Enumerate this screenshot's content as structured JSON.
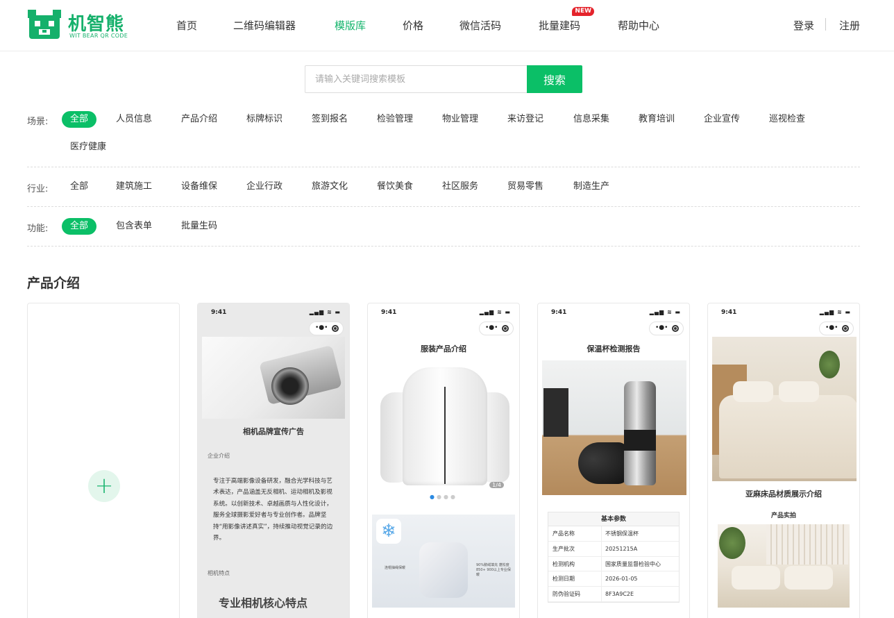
{
  "brand": {
    "name": "机智熊",
    "subtitle": "WIT BEAR QR CODE",
    "color": "#15b06b"
  },
  "nav": {
    "items": [
      {
        "label": "首页",
        "active": false
      },
      {
        "label": "二维码编辑器",
        "active": false
      },
      {
        "label": "模版库",
        "active": true
      },
      {
        "label": "价格",
        "active": false
      },
      {
        "label": "微信活码",
        "active": false
      },
      {
        "label": "批量建码",
        "active": false,
        "badge": "NEW"
      },
      {
        "label": "帮助中心",
        "active": false
      }
    ],
    "login": "登录",
    "register": "注册"
  },
  "search": {
    "placeholder": "请输入关键词搜索模板",
    "value": "",
    "button": "搜索"
  },
  "filters": {
    "scene": {
      "label": "场景:",
      "options": [
        "全部",
        "人员信息",
        "产品介绍",
        "标牌标识",
        "签到报名",
        "检验管理",
        "物业管理",
        "来访登记",
        "信息采集",
        "教育培训",
        "企业宣传",
        "巡视检查",
        "医疗健康"
      ],
      "selected": "全部"
    },
    "industry": {
      "label": "行业:",
      "options": [
        "全部",
        "建筑施工",
        "设备维保",
        "企业行政",
        "旅游文化",
        "餐饮美食",
        "社区服务",
        "贸易零售",
        "制造生产"
      ],
      "selected": ""
    },
    "feature": {
      "label": "功能:",
      "options": [
        "全部",
        "包含表单",
        "批量生码"
      ],
      "selected": "全部"
    }
  },
  "section": {
    "title": "产品介绍"
  },
  "phone": {
    "time": "9:41",
    "status_icons": "▂▄▆ ≋ ▬",
    "capsule_dots": "•●•"
  },
  "templates": {
    "add_icon": "plus-icon",
    "camera": {
      "title": "相机品牌宣传广告",
      "section1": "企业介绍",
      "body": "专注于高端影像设备研发，融合光学科技与艺术表达，产品涵盖无反相机、运动相机及影视系统。以创新技术、卓越画质与人性化设计，服务全球摄影爱好者与专业创作者。品牌坚持“用影像讲述真实”，持续推动视觉记录的边界。",
      "section2": "相机特点",
      "big_heading": "专业相机核心特点"
    },
    "jacket": {
      "title": "服装产品介绍",
      "counter": "1/4",
      "banner_left": "连帽抽绳保暖",
      "banner_right": "90%鹅绒填充 蓬松度850+ 900以上专业保暖"
    },
    "flask": {
      "title": "保温杯检测报告",
      "table_title": "基本参数",
      "rows": [
        {
          "k": "产品名称",
          "v": "不锈钢保温杯"
        },
        {
          "k": "生产批次",
          "v": "20251215A"
        },
        {
          "k": "检测机构",
          "v": "国家质量监督检验中心"
        },
        {
          "k": "检测日期",
          "v": "2026-01-05"
        },
        {
          "k": "防伪验证码",
          "v": "8F3A9C2E"
        }
      ]
    },
    "bedding": {
      "title": "亚麻床品材质展示介绍",
      "subtitle": "产品实拍"
    }
  },
  "colors": {
    "accent": "#0bbf67",
    "badge": "#e4232b"
  }
}
